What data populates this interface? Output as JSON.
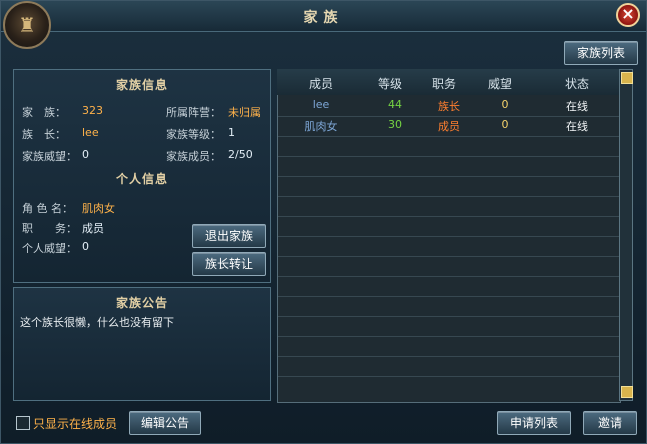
{
  "window": {
    "title": "家族"
  },
  "buttons": {
    "family_list": "家族列表",
    "leave_family": "退出家族",
    "transfer_leader": "族长转让",
    "edit_notice": "编辑公告",
    "apply_list": "申请列表",
    "invite": "邀请"
  },
  "family_info": {
    "title": "家族信息",
    "family_label": "家　族：",
    "family_value": "323",
    "camp_label": "所属阵营：",
    "camp_value": "未归属",
    "leader_label": "族　长：",
    "leader_value": "lee",
    "level_label": "家族等级：",
    "level_value": "1",
    "prestige_label": "家族威望：",
    "prestige_value": "0",
    "members_label": "家族成员：",
    "members_value": "2/50"
  },
  "personal_info": {
    "title": "个人信息",
    "role_label": "角 色 名：",
    "role_value": "肌肉女",
    "job_label": "职　　务：",
    "job_value": "成员",
    "prestige_label": "个人威望：",
    "prestige_value": "0"
  },
  "notice": {
    "title": "家族公告",
    "text": "这个族长很懒，什么也没有留下"
  },
  "member_table": {
    "headers": [
      "成员",
      "等级",
      "职务",
      "威望",
      "状态"
    ],
    "rows": [
      {
        "name": "lee",
        "level": "44",
        "role": "族长",
        "prestige": "0",
        "status": "在线"
      },
      {
        "name": "肌肉女",
        "level": "30",
        "role": "成员",
        "prestige": "0",
        "status": "在线"
      }
    ]
  },
  "filters": {
    "online_only": "只显示在线成员"
  },
  "colors": {
    "accent": "#e5d7b1",
    "orange": "#ffb24a",
    "green": "#75d443",
    "blue_name": "#7ea7d7"
  }
}
